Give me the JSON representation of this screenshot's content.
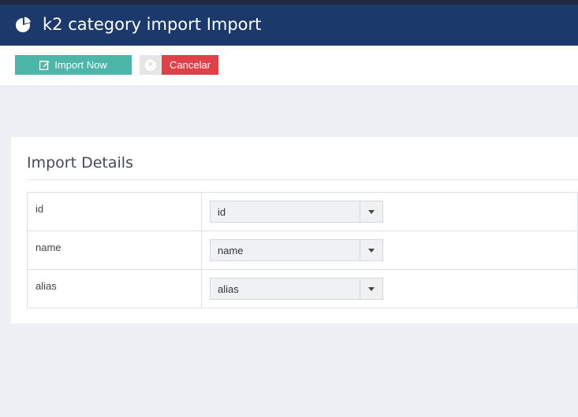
{
  "header": {
    "title": "k2 category import Import",
    "logo_icon": "pie-chart-icon",
    "bg_color": "#1b3a6b"
  },
  "toolbar": {
    "import_label": "Import Now",
    "import_icon": "edit-icon",
    "cancel_label": "Cancelar",
    "cancel_icon": "close-circle-icon",
    "import_color": "#4cb7a8",
    "cancel_color": "#e04048"
  },
  "panel": {
    "heading": "Import Details",
    "rows": [
      {
        "label": "id",
        "value": "id"
      },
      {
        "label": "name",
        "value": "name"
      },
      {
        "label": "alias",
        "value": "alias"
      }
    ]
  }
}
